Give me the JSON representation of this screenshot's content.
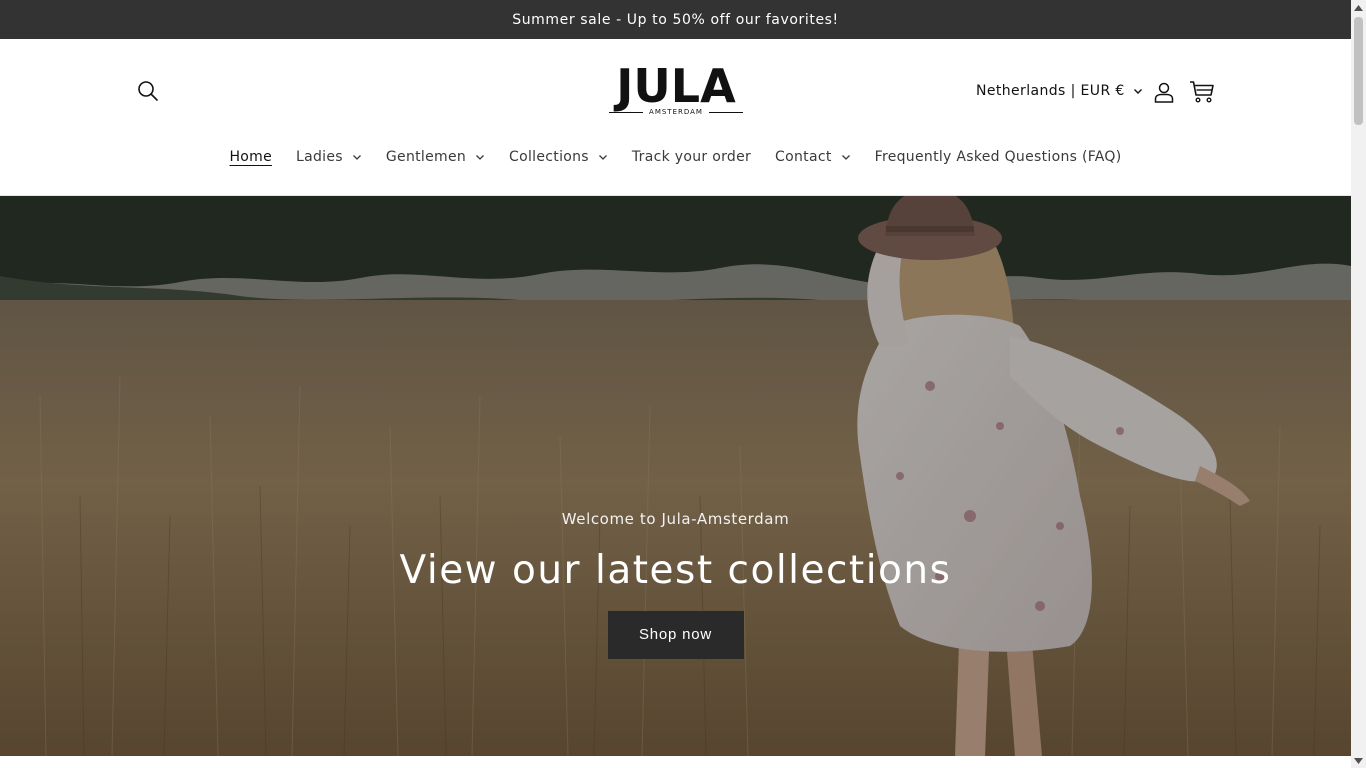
{
  "announcement": {
    "text": "Summer sale - Up to 50% off our favorites!"
  },
  "header": {
    "search_icon": "search-icon",
    "logo": {
      "word": "JULA",
      "sub": "AMSTERDAM"
    },
    "country_selector": "Netherlands | EUR €",
    "account_icon": "user-icon",
    "cart_icon": "cart-icon"
  },
  "nav": {
    "items": [
      {
        "label": "Home",
        "active": true,
        "dropdown": false
      },
      {
        "label": "Ladies",
        "active": false,
        "dropdown": true
      },
      {
        "label": "Gentlemen",
        "active": false,
        "dropdown": true
      },
      {
        "label": "Collections",
        "active": false,
        "dropdown": true
      },
      {
        "label": "Track your order",
        "active": false,
        "dropdown": false
      },
      {
        "label": "Contact",
        "active": false,
        "dropdown": true
      },
      {
        "label": "Frequently Asked Questions (FAQ)",
        "active": false,
        "dropdown": false
      }
    ]
  },
  "hero": {
    "kicker": "Welcome to Jula-Amsterdam",
    "title": "View our latest collections",
    "button": "Shop now"
  },
  "colors": {
    "announcement_bg": "#333333",
    "button_bg": "#2a2a2a",
    "text": "#121212"
  }
}
